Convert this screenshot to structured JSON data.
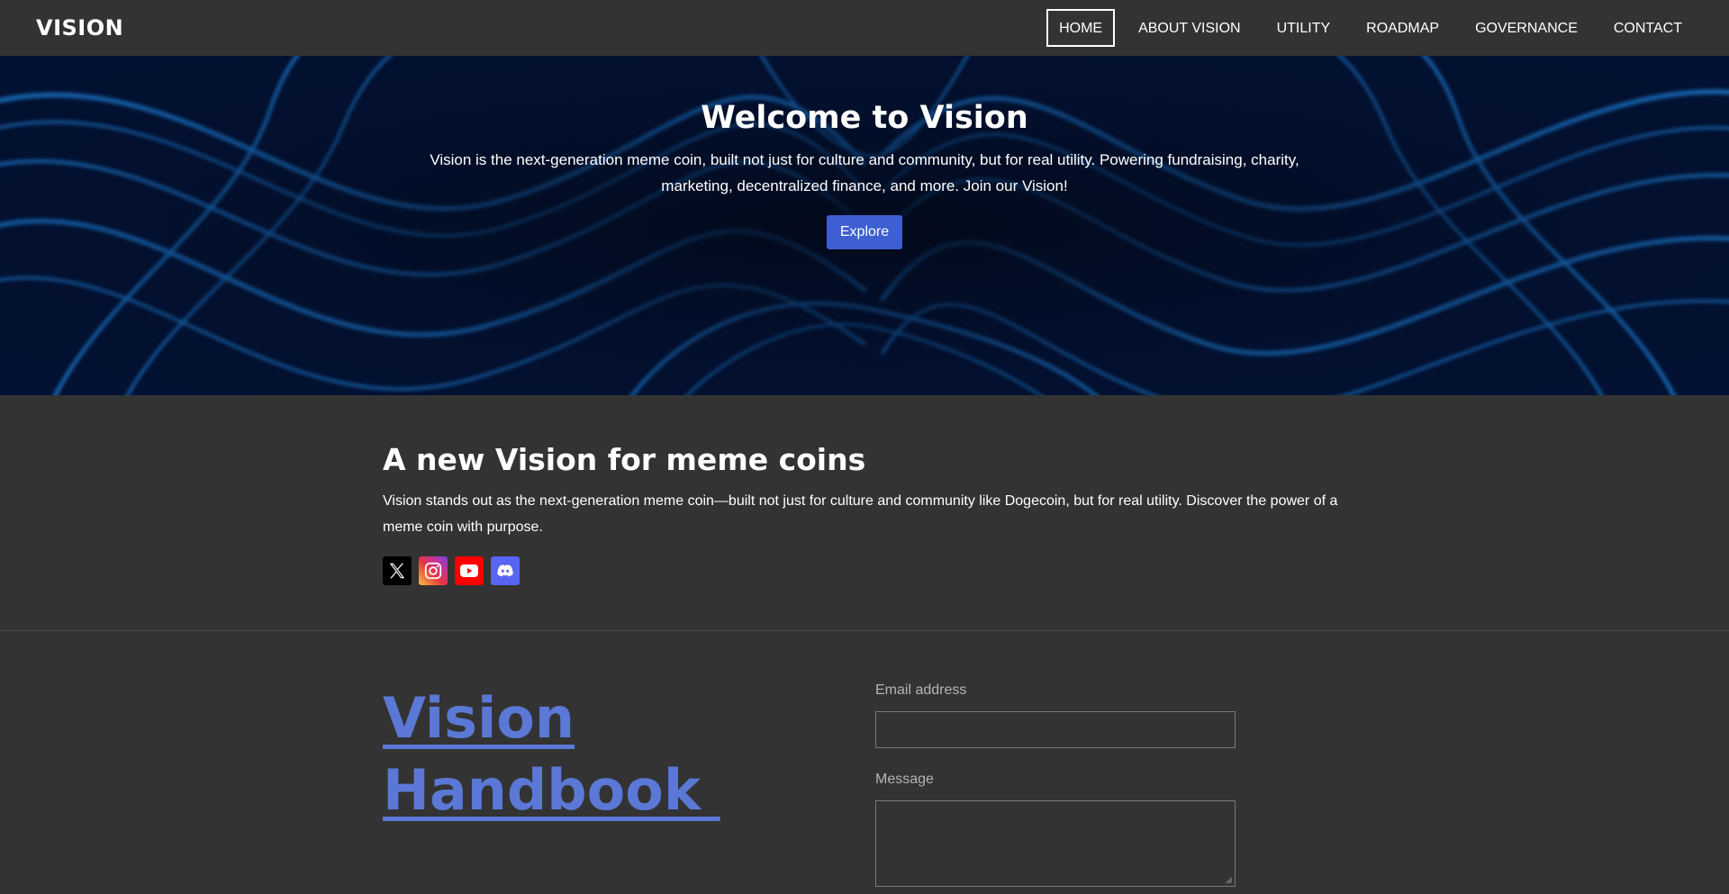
{
  "brand": "VISION",
  "nav": {
    "items": [
      "HOME",
      "ABOUT VISION",
      "UTILITY",
      "ROADMAP",
      "GOVERNANCE",
      "CONTACT"
    ],
    "active": "HOME"
  },
  "hero": {
    "title": "Welcome to Vision",
    "text": "Vision is the next-generation meme coin, built not just for culture and community, but for real utility. Powering fundraising, charity, marketing, decentralized finance, and more. Join our Vision!",
    "button": "Explore"
  },
  "about": {
    "title": "A new Vision for meme coins",
    "text": "Vision stands out as the next-generation meme coin—built not just for culture and community like Dogecoin, but for real utility. Discover the power of a meme coin with purpose."
  },
  "socials": [
    {
      "icon": "x-icon",
      "color": "#000000"
    },
    {
      "icon": "instagram-icon",
      "color": "#c233a1"
    },
    {
      "icon": "youtube-icon",
      "color": "#ff0000"
    },
    {
      "icon": "discord-icon",
      "color": "#5865f2"
    }
  ],
  "handbook": {
    "line1": "Vision",
    "line2": "Handbook"
  },
  "form": {
    "email_label": "Email address",
    "email_value": "",
    "message_label": "Message",
    "message_value": ""
  },
  "colors": {
    "background": "#333333",
    "accent": "#3e5fd1",
    "link": "#5b78d6"
  }
}
